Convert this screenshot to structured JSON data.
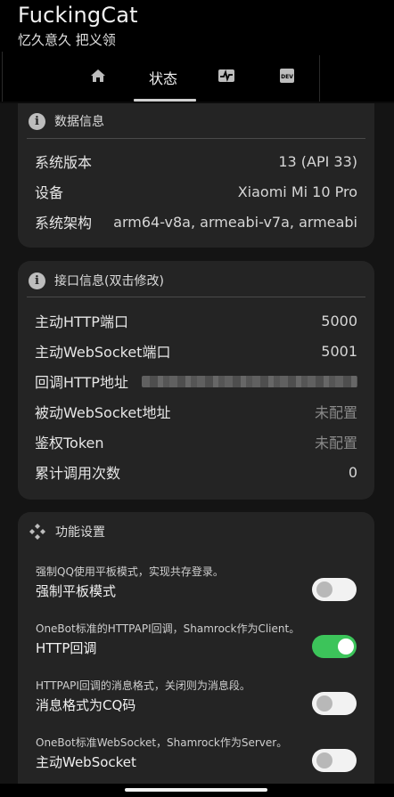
{
  "app": {
    "title": "FuckingCat",
    "subtitle": "忆久意久 把义领"
  },
  "tabs": [
    {
      "id": "home",
      "icon": "home-icon"
    },
    {
      "id": "status",
      "label": "状态",
      "selected": true
    },
    {
      "id": "activity",
      "icon": "heartbeat-icon"
    },
    {
      "id": "dev",
      "icon": "dev-icon",
      "icon_text": "DEV"
    }
  ],
  "device_card": {
    "title": "数据信息",
    "rows": [
      {
        "key": "系统版本",
        "value": "13 (API 33)"
      },
      {
        "key": "设备",
        "value": "Xiaomi Mi 10 Pro"
      },
      {
        "key": "系统架构",
        "value": "arm64-v8a, armeabi-v7a, armeabi"
      }
    ]
  },
  "api_card": {
    "title": "接口信息(双击修改)",
    "rows": [
      {
        "key": "主动HTTP端口",
        "value": "5000"
      },
      {
        "key": "主动WebSocket端口",
        "value": "5001"
      },
      {
        "key": "回调HTTP地址",
        "value": ""
      },
      {
        "key": "被动WebSocket地址",
        "value": "未配置"
      },
      {
        "key": "鉴权Token",
        "value": "未配置"
      },
      {
        "key": "累计调用次数",
        "value": "0"
      }
    ]
  },
  "func_card": {
    "title": "功能设置",
    "settings": [
      {
        "desc": "强制QQ使用平板模式，实现共存登录。",
        "name": "强制平板模式",
        "enabled": false
      },
      {
        "desc": "OneBot标准的HTTPAPI回调，Shamrock作为Client。",
        "name": "HTTP回调",
        "enabled": true
      },
      {
        "desc": "HTTPAPI回调的消息格式，关闭则为消息段。",
        "name": "消息格式为CQ码",
        "enabled": false
      },
      {
        "desc": "OneBot标准WebSocket，Shamrock作为Server。",
        "name": "主动WebSocket",
        "enabled": false
      }
    ]
  },
  "colors": {
    "background": "#141414",
    "card": "#242424",
    "toggle_on": "#3cc45a",
    "toggle_off": "#f2f2f2"
  }
}
